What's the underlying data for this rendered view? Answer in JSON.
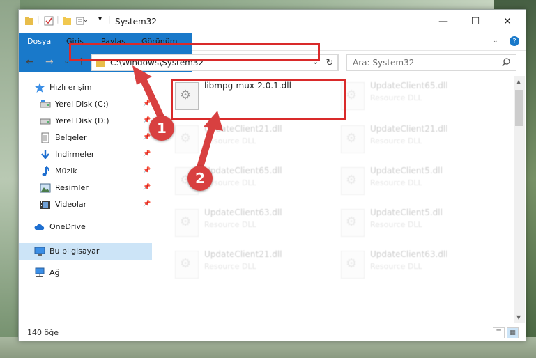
{
  "window": {
    "title": "System32",
    "controls": {
      "minimize": "—",
      "maximize": "☐",
      "close": "✕"
    }
  },
  "ribbon": {
    "tabs": [
      "Dosya",
      "Giriş",
      "Paylaş",
      "Görünüm"
    ],
    "help": "?"
  },
  "navigation": {
    "back": "←",
    "forward": "→",
    "recent": "⌄",
    "up": "↑",
    "address": "C:\\Windows\\System32",
    "refresh": "↻",
    "search_placeholder": "Ara: System32"
  },
  "sidebar": {
    "quick_access": "Hızlı erişim",
    "items": [
      {
        "label": "Yerel Disk (C:)",
        "icon": "drive-icon",
        "pinned": true
      },
      {
        "label": "Yerel Disk (D:)",
        "icon": "drive-icon",
        "pinned": true
      },
      {
        "label": "Belgeler",
        "icon": "documents-icon",
        "pinned": true
      },
      {
        "label": "İndirmeler",
        "icon": "download-icon",
        "pinned": true
      },
      {
        "label": "Müzik",
        "icon": "music-icon",
        "pinned": true
      },
      {
        "label": "Resimler",
        "icon": "pictures-icon",
        "pinned": true
      },
      {
        "label": "Videolar",
        "icon": "videos-icon",
        "pinned": true
      }
    ],
    "onedrive": "OneDrive",
    "this_pc": "Bu bilgisayar",
    "network": "Ağ"
  },
  "files": {
    "main": {
      "name": "libmpg-mux-2.0.1.dll"
    },
    "faded": [
      {
        "name": "UpdateClient65.dll",
        "type": "Resource DLL"
      },
      {
        "name": "UpdateClient21.dll",
        "type": "Resource DLL"
      },
      {
        "name": "UpdateClient21.dll",
        "type": "Resource DLL"
      },
      {
        "name": "UpdateClient65.dll",
        "type": "Resource DLL"
      },
      {
        "name": "UpdateClient5.dll",
        "type": "Resource DLL"
      },
      {
        "name": "UpdateClient63.dll",
        "type": "Resource DLL"
      },
      {
        "name": "UpdateClient5.dll",
        "type": "Resource DLL"
      },
      {
        "name": "UpdateClient21.dll",
        "type": "Resource DLL"
      },
      {
        "name": "UpdateClient63.dll",
        "type": "Resource DLL"
      }
    ]
  },
  "status": {
    "count": "140 öğe"
  },
  "annotations": {
    "step1": "1",
    "step2": "2",
    "color": "#d84040"
  },
  "colors": {
    "accent": "#1979ca",
    "highlight": "#d92a2a",
    "selected": "#cce4f7"
  }
}
